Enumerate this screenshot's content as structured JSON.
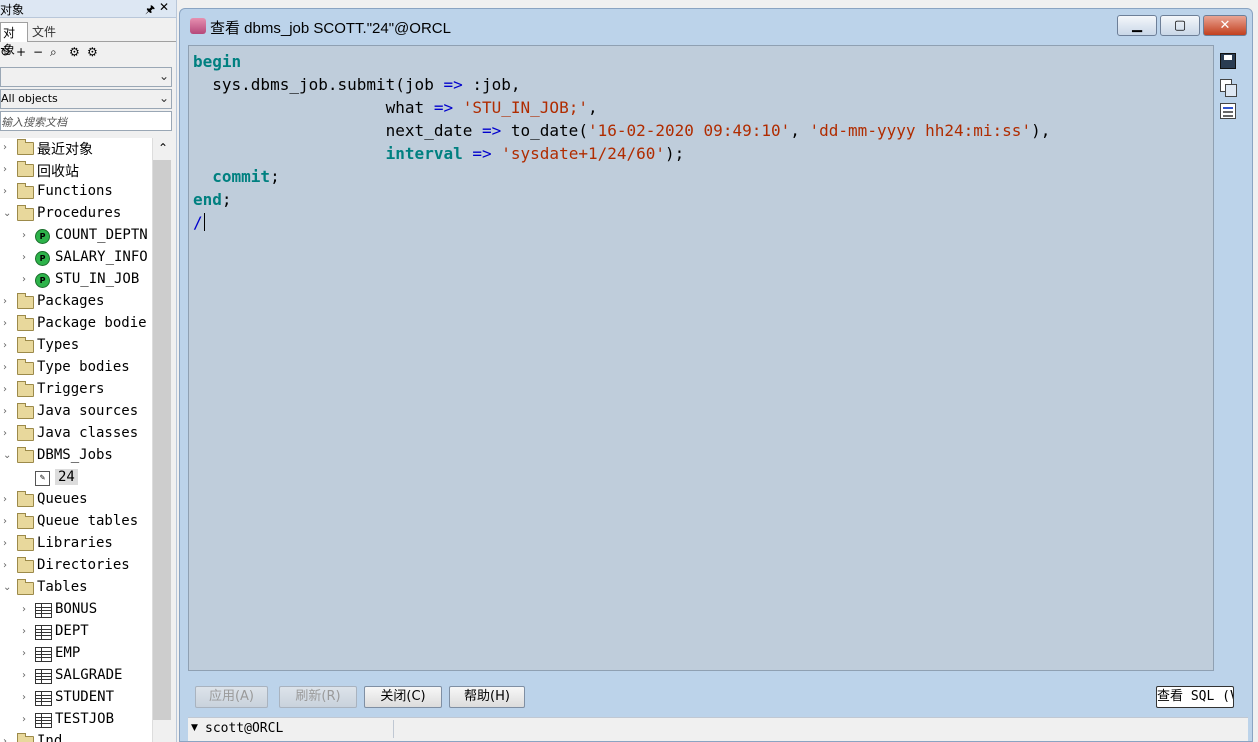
{
  "left_panel": {
    "title": "对象",
    "pin_glyph": "🖈",
    "close_glyph": "✕",
    "tabs": [
      "对象",
      "文件"
    ],
    "toolbar_glyphs": [
      "↻",
      "+",
      "−",
      "⌕",
      "⚙",
      "⚙"
    ],
    "combo1_value": "",
    "combo2_value": "All objects",
    "search_placeholder": "输入搜索文档",
    "tree": [
      {
        "label": "最近对象",
        "type": "folder",
        "expander": "›"
      },
      {
        "label": "回收站",
        "type": "folder",
        "expander": "›"
      },
      {
        "label": "Functions",
        "type": "folder",
        "expander": "›"
      },
      {
        "label": "Procedures",
        "type": "folder",
        "expander": "⌄"
      },
      {
        "label": "COUNT_DEPTN",
        "type": "proc",
        "expander": "›"
      },
      {
        "label": "SALARY_INFO",
        "type": "proc",
        "expander": "›"
      },
      {
        "label": "STU_IN_JOB",
        "type": "proc",
        "expander": "›"
      },
      {
        "label": "Packages",
        "type": "folder",
        "expander": "›"
      },
      {
        "label": "Package bodie",
        "type": "folder",
        "expander": "›"
      },
      {
        "label": "Types",
        "type": "folder",
        "expander": "›"
      },
      {
        "label": "Type bodies",
        "type": "folder",
        "expander": "›"
      },
      {
        "label": "Triggers",
        "type": "folder",
        "expander": "›"
      },
      {
        "label": "Java sources",
        "type": "folder",
        "expander": "›"
      },
      {
        "label": "Java classes",
        "type": "folder",
        "expander": "›"
      },
      {
        "label": "DBMS_Jobs",
        "type": "folder",
        "expander": "⌄"
      },
      {
        "label": "24",
        "type": "job",
        "expander": ""
      },
      {
        "label": "Queues",
        "type": "folder",
        "expander": "›"
      },
      {
        "label": "Queue tables",
        "type": "folder",
        "expander": "›"
      },
      {
        "label": "Libraries",
        "type": "folder",
        "expander": "›"
      },
      {
        "label": "Directories",
        "type": "folder",
        "expander": "›"
      },
      {
        "label": "Tables",
        "type": "folder",
        "expander": "⌄"
      },
      {
        "label": "BONUS",
        "type": "table",
        "expander": "›"
      },
      {
        "label": "DEPT",
        "type": "table",
        "expander": "›"
      },
      {
        "label": "EMP",
        "type": "table",
        "expander": "›"
      },
      {
        "label": "SALGRADE",
        "type": "table",
        "expander": "›"
      },
      {
        "label": "STUDENT",
        "type": "table",
        "expander": "›"
      },
      {
        "label": "TESTJOB",
        "type": "table",
        "expander": "›"
      },
      {
        "label": "Ind",
        "type": "folder",
        "expander": "›"
      }
    ]
  },
  "window": {
    "title": "查看 dbms_job SCOTT.\"24\"@ORCL",
    "minimize_glyph": "▁",
    "maximize_glyph": "▢",
    "close_glyph": "✕"
  },
  "code": {
    "l1_kw": "begin",
    "l2_a": "  sys.dbms_job.submit(job ",
    "l2_op": "=>",
    "l2_b": " :job,",
    "l3_pad": "                    what ",
    "l3_op": "=>",
    "l3_str": "'STU_IN_JOB;'",
    "l3_end": ",",
    "l4_pad": "                    next_date ",
    "l4_op": "=>",
    "l4_b": " to_date(",
    "l4_str1": "'16-02-2020 09:49:10'",
    "l4_c": ", ",
    "l4_str2": "'dd-mm-yyyy hh24:mi:ss'",
    "l4_end": "),",
    "l5_pad": "                    ",
    "l5_kw": "interval",
    "l5_op": "=>",
    "l5_str": "'sysdate+1/24/60'",
    "l5_end": ");",
    "l6_pad": "  ",
    "l6_kw": "commit",
    "l6_end": ";",
    "l7_kw": "end",
    "l7_end": ";",
    "l8": "/"
  },
  "buttons": {
    "apply": "应用(A)",
    "refresh": "刷新(R)",
    "close": "关闭(C)",
    "help": "帮助(H)",
    "view_sql": "查看 SQL (V)"
  },
  "status": {
    "arrow": "▼",
    "connection": "scott@ORCL"
  }
}
